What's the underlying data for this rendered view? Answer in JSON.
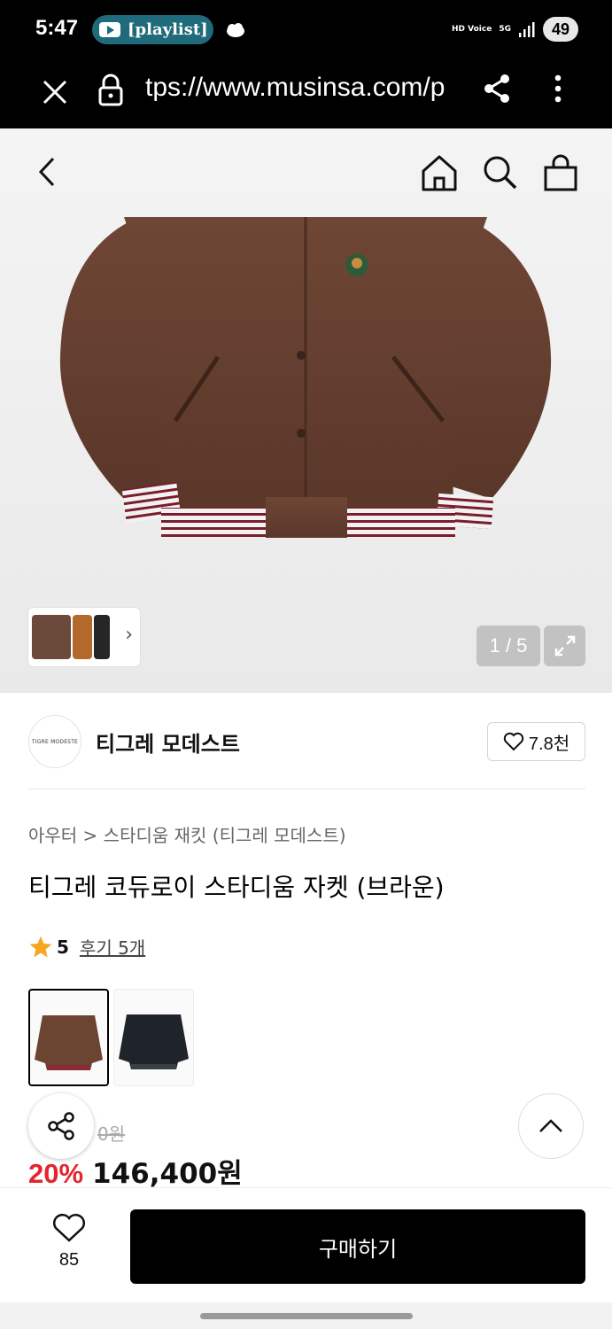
{
  "status_bar": {
    "time": "5:47",
    "notification_label": "[playlist]",
    "signal_tags": [
      "HD Voice",
      "5G"
    ],
    "battery": "49"
  },
  "browser": {
    "url": "tps://www.musinsa.com/p"
  },
  "gallery": {
    "counter": "1 / 5",
    "thumb_arrow": "›"
  },
  "brand": {
    "logo_text": "TIGRE MODESTE",
    "name": "티그레 모데스트",
    "likes": "7.8천"
  },
  "product": {
    "breadcrumb": "아우터 > 스타디움 재킷 (티그레 모데스트)",
    "title": "티그레 코듀로이 스타디움 자켓 (브라운)",
    "rating": "5",
    "reviews": "후기 5개",
    "original_price_fragment": "0원",
    "discount": "20%",
    "price": "146,400원"
  },
  "bottom": {
    "wish_count": "85",
    "buy_label": "구매하기"
  },
  "colors": {
    "accent_red": "#e2252f",
    "jacket_brown": "#6b4432",
    "buy_black": "#000000"
  },
  "icons": [
    "close-icon",
    "lock-icon",
    "share-icon",
    "more-icon",
    "back-icon",
    "home-icon",
    "search-icon",
    "cart-icon",
    "expand-icon",
    "heart-icon",
    "star-icon",
    "chevron-up-icon"
  ]
}
